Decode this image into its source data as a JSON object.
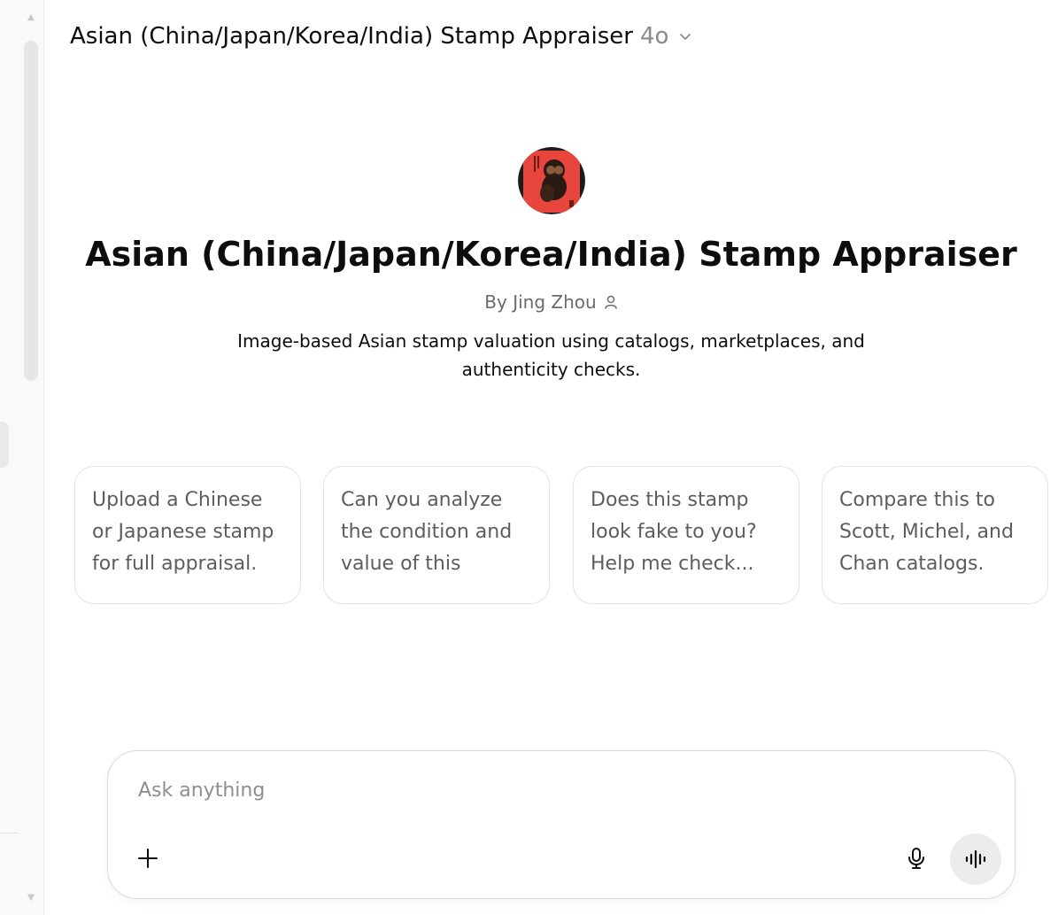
{
  "header": {
    "gpt_name": "Asian (China/Japan/Korea/India) Stamp Appraiser",
    "model": "4o",
    "dropdown_icon": "chevron-down-icon"
  },
  "gpt": {
    "avatar_icon": "monkey-stamp-avatar",
    "title": "Asian (China/Japan/Korea/India) Stamp Appraiser",
    "byline": "By Jing Zhou",
    "byline_icon": "person-icon",
    "description": "Image-based Asian stamp valuation using catalogs, marketplaces, and authenticity checks."
  },
  "starters": [
    "Upload a Chinese or Japanese stamp for full appraisal.",
    "Can you analyze the condition and value of this stamp?",
    "Does this stamp look fake to you? Help me check...",
    "Compare this to Scott, Michel, and Chan catalogs."
  ],
  "composer": {
    "placeholder": "Ask anything",
    "add_icon": "plus-icon",
    "mic_icon": "microphone-icon",
    "voice_icon": "voice-mode-icon"
  },
  "colors": {
    "avatar_background": "#e8453c",
    "muted_text": "#6b6b6b",
    "border": "#e3e3e3"
  }
}
